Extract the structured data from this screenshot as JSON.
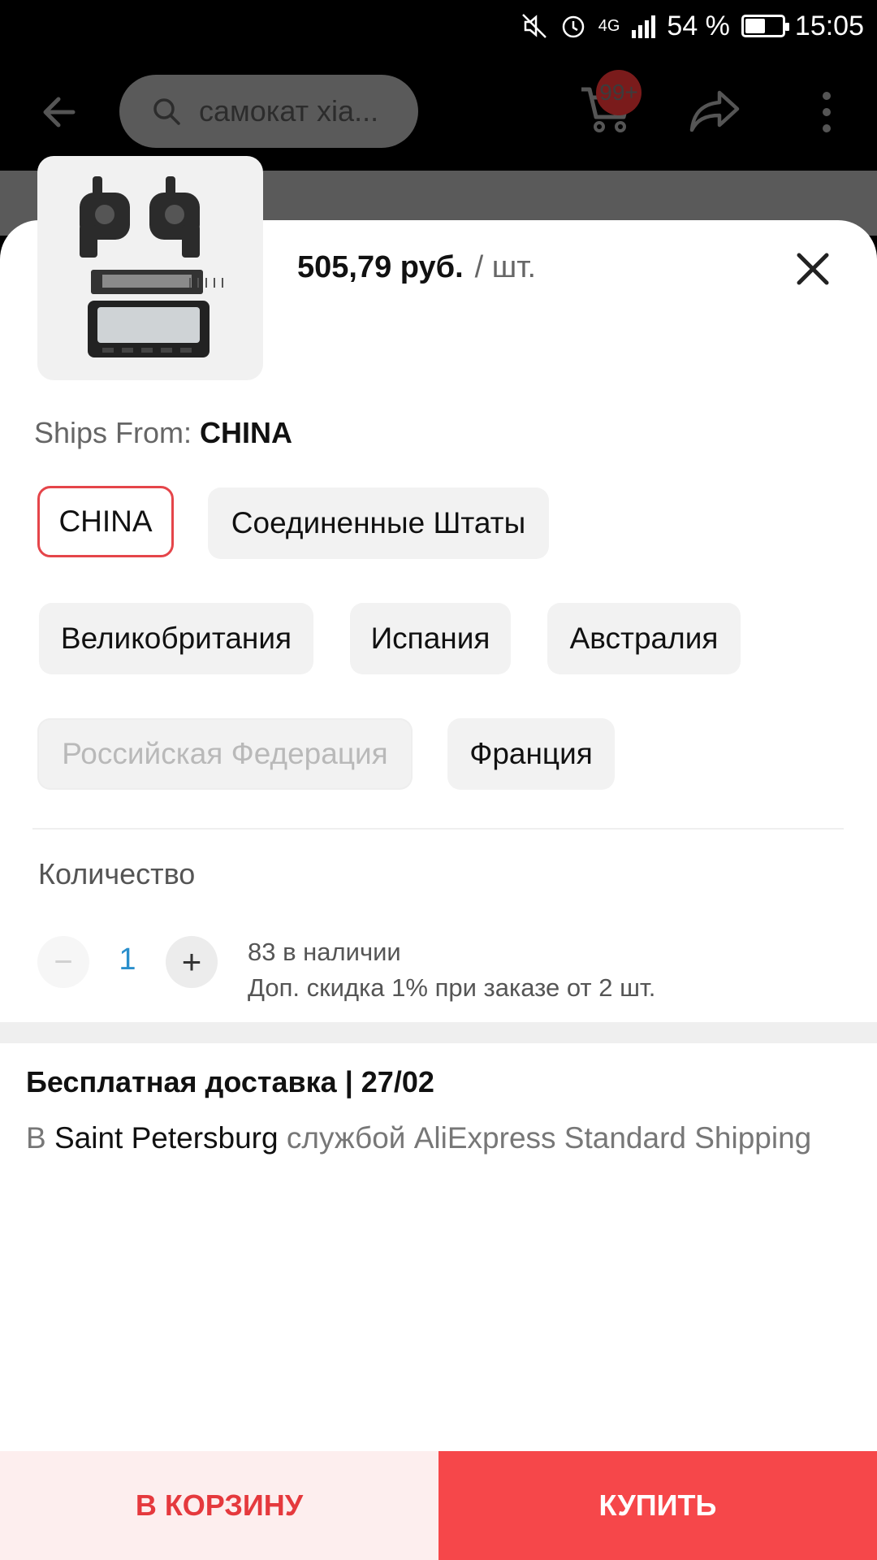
{
  "status_bar": {
    "battery_text": "54 %",
    "battery_level": 0.54,
    "time": "15:05",
    "network": "4G",
    "icons": [
      "mute-icon",
      "alarm-icon",
      "signal-icon",
      "battery-icon"
    ]
  },
  "header": {
    "search_text": "самокат xia...",
    "cart_badge": "99+",
    "icons": [
      "back-arrow-icon",
      "search-icon",
      "cart-icon",
      "share-icon",
      "more-vertical-icon"
    ]
  },
  "product": {
    "price": "505,79 руб.",
    "unit": "/ шт."
  },
  "ships_from": {
    "label": "Ships From:",
    "value": "CHINA",
    "options": [
      {
        "label": "CHINA",
        "state": "selected"
      },
      {
        "label": "Соединенные Штаты",
        "state": "normal"
      },
      {
        "label": "Великобритания",
        "state": "normal"
      },
      {
        "label": "Испания",
        "state": "normal"
      },
      {
        "label": "Австралия",
        "state": "normal"
      },
      {
        "label": "Российская Федерация",
        "state": "disabled"
      },
      {
        "label": "Франция",
        "state": "normal"
      }
    ]
  },
  "quantity": {
    "title": "Количество",
    "value": "1",
    "minus": "−",
    "plus": "+",
    "stock": "83 в наличии",
    "discount": "Доп. скидка 1% при заказе от 2 шт."
  },
  "shipping": {
    "title": "Бесплатная доставка | 27/02",
    "prefix": "В",
    "city": "Saint Petersburg",
    "suffix": "службой AliExpress Standard Shipping"
  },
  "actions": {
    "add_to_cart": "В КОРЗИНУ",
    "buy": "КУПИТЬ"
  },
  "colors": {
    "accent": "#f6474a",
    "accent_light": "#fdeeee",
    "selected_border": "#e5454a",
    "qty_value": "#2a8fcc"
  }
}
